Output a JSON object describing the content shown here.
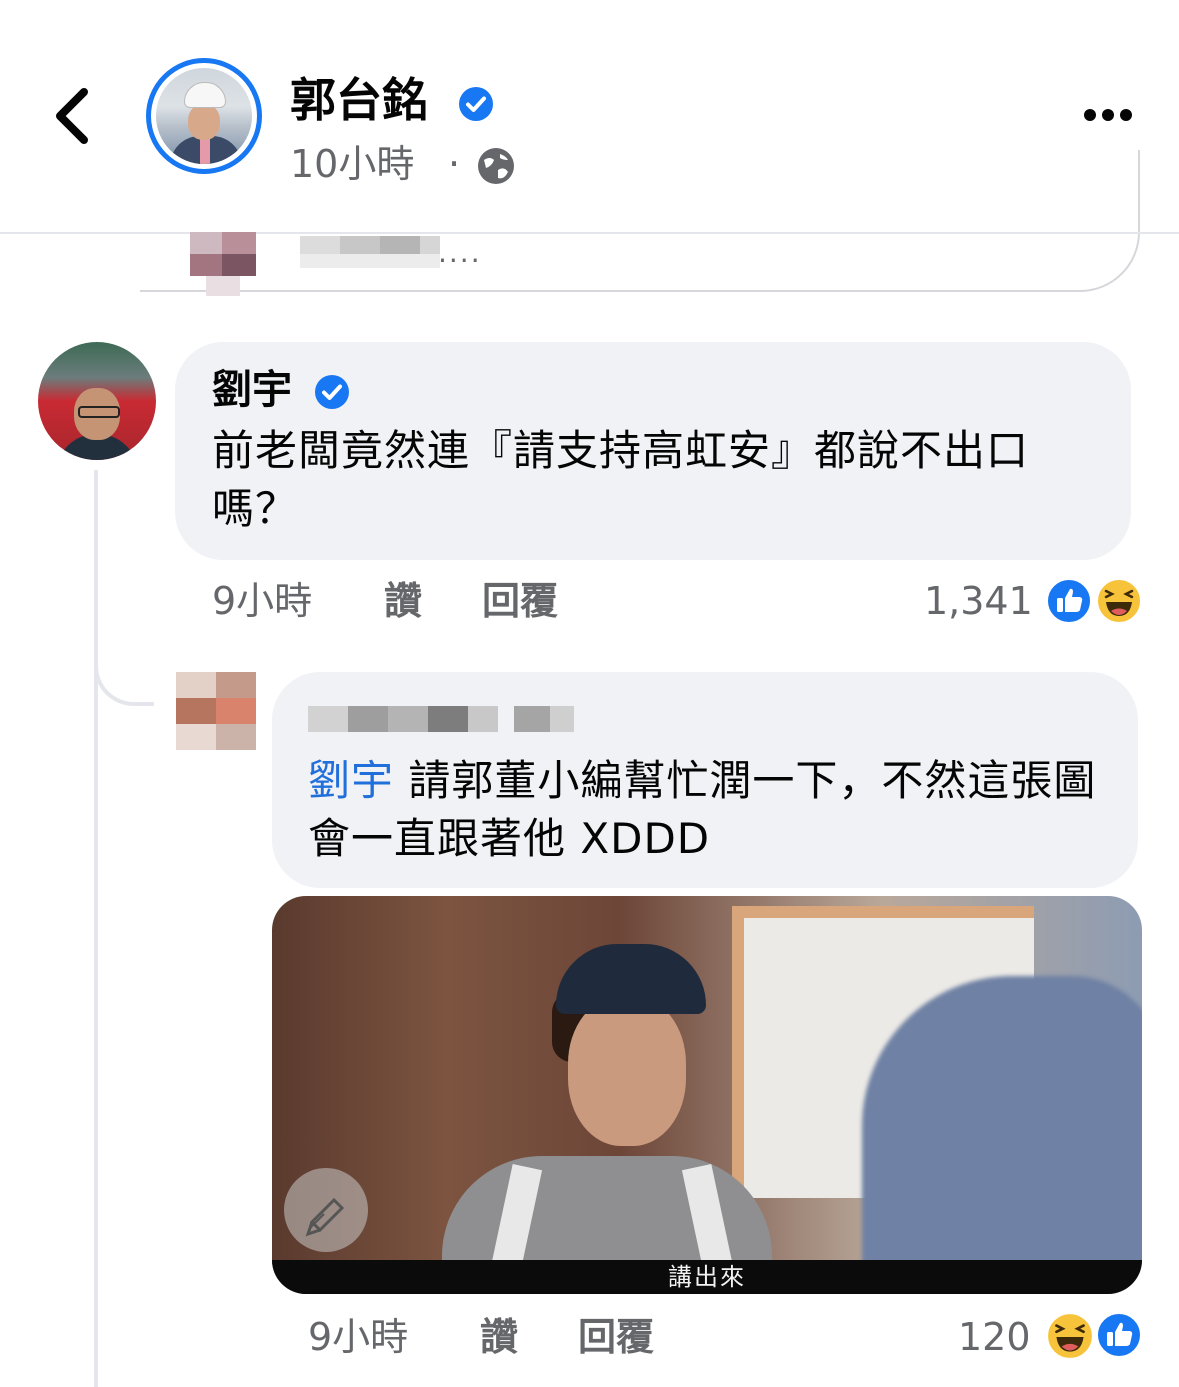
{
  "post": {
    "author": "郭台銘",
    "time": "10小時",
    "separator": "·",
    "prev_comment_snippet": "...."
  },
  "comment1": {
    "author": "劉宇",
    "text": "前老闆竟然連『請支持高虹安』都說不出口嗎？",
    "time": "9小時",
    "like_label": "讚",
    "reply_label": "回覆",
    "reaction_count": "1,341"
  },
  "comment2": {
    "mention": "劉宇",
    "text": " 請郭董小編幫忙潤一下，不然這張圖會一直跟著他 XDDD",
    "image_caption": "講出來",
    "time": "9小時",
    "like_label": "讚",
    "reply_label": "回覆",
    "reaction_count": "120"
  },
  "colors": {
    "accent_blue": "#1877f2",
    "mention_blue": "#216fdb",
    "bubble_bg": "#f0f2f5",
    "meta_gray": "#65676b"
  }
}
